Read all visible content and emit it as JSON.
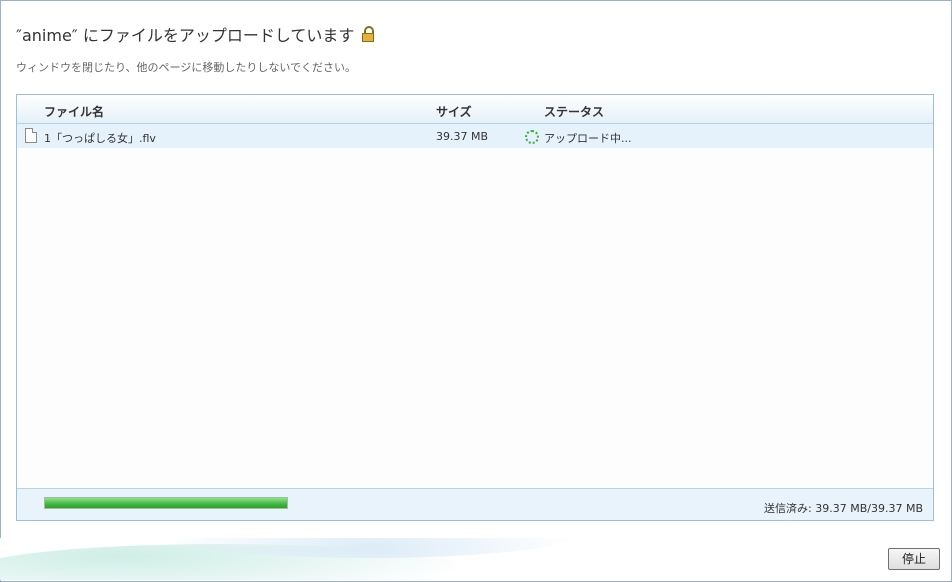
{
  "dialog": {
    "title": "″anime″ にファイルをアップロードしています",
    "subtitle": "ウィンドウを閉じたり、他のページに移動したりしないでください。",
    "lock_icon": "lock-icon"
  },
  "table": {
    "columns": [
      "ファイル名",
      "サイズ",
      "ステータス"
    ],
    "rows": [
      {
        "icon": "file-icon",
        "name": "1「つっぱしる女」.flv",
        "size": "39.37 MB",
        "status_icon": "loading-spinner-icon",
        "status": "アップロード中..."
      }
    ]
  },
  "progress": {
    "fraction": 1.0,
    "color": "#3fb83f",
    "sent_text": "送信済み: 39.37 MB/39.37 MB"
  },
  "buttons": {
    "stop_label": "停止"
  }
}
